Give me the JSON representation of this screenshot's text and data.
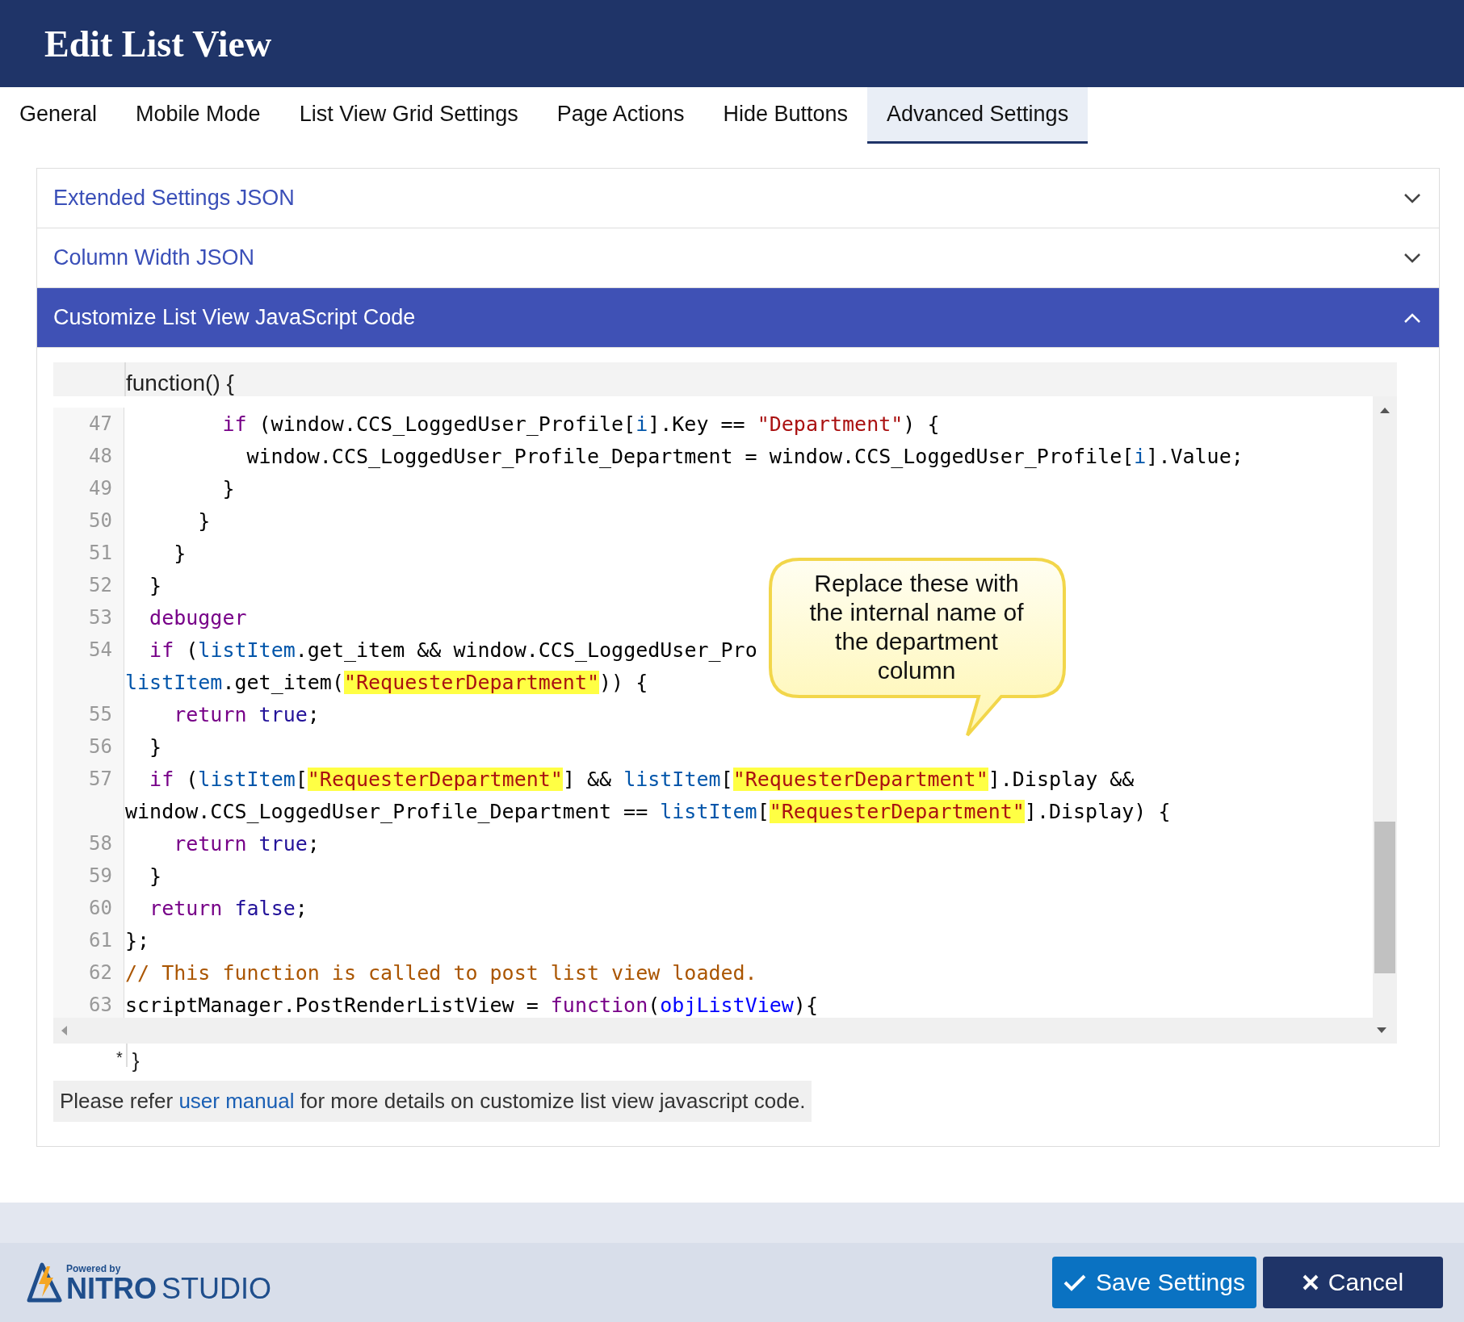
{
  "window": {
    "title": "Edit List View"
  },
  "tabs": [
    {
      "label": "General",
      "selected": false
    },
    {
      "label": "Mobile Mode",
      "selected": false
    },
    {
      "label": "List View Grid Settings",
      "selected": false
    },
    {
      "label": "Page Actions",
      "selected": false
    },
    {
      "label": "Hide Buttons",
      "selected": false
    },
    {
      "label": "Advanced Settings",
      "selected": true
    }
  ],
  "sections": [
    {
      "title": "Extended Settings JSON",
      "expanded": false
    },
    {
      "title": "Column Width JSON",
      "expanded": false
    },
    {
      "title": "Customize List View JavaScript Code",
      "expanded": true
    }
  ],
  "editor": {
    "header": "function() {",
    "footer_mark": "*",
    "footer_brace": "}",
    "lines": [
      {
        "number": "47",
        "tokens": [
          {
            "kind": "keyword",
            "text": "        if"
          },
          {
            "kind": "plain",
            "text": " (window.CCS_LoggedUser_Profile["
          },
          {
            "kind": "variable",
            "text": "i"
          },
          {
            "kind": "plain",
            "text": "].Key == "
          },
          {
            "kind": "string",
            "text": "\"Department\"",
            "highlighted": false
          },
          {
            "kind": "plain",
            "text": ") {"
          }
        ]
      },
      {
        "number": "48",
        "tokens": [
          {
            "kind": "plain",
            "text": "          window.CCS_LoggedUser_Profile_Department = window.CCS_LoggedUser_Profile["
          },
          {
            "kind": "variable",
            "text": "i"
          },
          {
            "kind": "plain",
            "text": "].Value;"
          }
        ]
      },
      {
        "number": "49",
        "tokens": [
          {
            "kind": "plain",
            "text": "        }"
          }
        ]
      },
      {
        "number": "50",
        "tokens": [
          {
            "kind": "plain",
            "text": "      }"
          }
        ]
      },
      {
        "number": "51",
        "tokens": [
          {
            "kind": "plain",
            "text": "    }"
          }
        ]
      },
      {
        "number": "52",
        "tokens": [
          {
            "kind": "plain",
            "text": "  }"
          }
        ]
      },
      {
        "number": "53",
        "tokens": [
          {
            "kind": "keyword",
            "text": "  debugger"
          }
        ]
      },
      {
        "number": "54",
        "tokens": [
          {
            "kind": "keyword",
            "text": "  if"
          },
          {
            "kind": "plain",
            "text": " ("
          },
          {
            "kind": "variable",
            "text": "listItem"
          },
          {
            "kind": "plain",
            "text": ".get_item && window.CCS_LoggedUser_Pro"
          }
        ]
      },
      {
        "tokens": [
          {
            "kind": "variable",
            "text": "listItem"
          },
          {
            "kind": "plain",
            "text": ".get_item("
          },
          {
            "kind": "string",
            "text": "\"RequesterDepartment\"",
            "highlighted": true
          },
          {
            "kind": "plain",
            "text": ")) {"
          }
        ]
      },
      {
        "number": "55",
        "tokens": [
          {
            "kind": "keyword",
            "text": "    return"
          },
          {
            "kind": "atom",
            "text": " true"
          },
          {
            "kind": "plain",
            "text": ";"
          }
        ]
      },
      {
        "number": "56",
        "tokens": [
          {
            "kind": "plain",
            "text": "  }"
          }
        ]
      },
      {
        "number": "57",
        "tokens": [
          {
            "kind": "keyword",
            "text": "  if"
          },
          {
            "kind": "plain",
            "text": " ("
          },
          {
            "kind": "variable",
            "text": "listItem"
          },
          {
            "kind": "plain",
            "text": "["
          },
          {
            "kind": "string",
            "text": "\"RequesterDepartment\"",
            "highlighted": true
          },
          {
            "kind": "plain",
            "text": "] && "
          },
          {
            "kind": "variable",
            "text": "listItem"
          },
          {
            "kind": "plain",
            "text": "["
          },
          {
            "kind": "string",
            "text": "\"RequesterDepartment\"",
            "highlighted": true
          },
          {
            "kind": "plain",
            "text": "].Display &&"
          }
        ]
      },
      {
        "tokens": [
          {
            "kind": "plain",
            "text": "window.CCS_LoggedUser_Profile_Department == "
          },
          {
            "kind": "variable",
            "text": "listItem"
          },
          {
            "kind": "plain",
            "text": "["
          },
          {
            "kind": "string",
            "text": "\"RequesterDepartment\"",
            "highlighted": true
          },
          {
            "kind": "plain",
            "text": "].Display) {"
          }
        ]
      },
      {
        "number": "58",
        "tokens": [
          {
            "kind": "keyword",
            "text": "    return"
          },
          {
            "kind": "atom",
            "text": " true"
          },
          {
            "kind": "plain",
            "text": ";"
          }
        ]
      },
      {
        "number": "59",
        "tokens": [
          {
            "kind": "plain",
            "text": "  }"
          }
        ]
      },
      {
        "number": "60",
        "tokens": [
          {
            "kind": "keyword",
            "text": "  return"
          },
          {
            "kind": "atom",
            "text": " false"
          },
          {
            "kind": "plain",
            "text": ";"
          }
        ]
      },
      {
        "number": "61",
        "tokens": [
          {
            "kind": "plain",
            "text": "};"
          }
        ]
      },
      {
        "number": "62",
        "tokens": [
          {
            "kind": "comment",
            "text": "// This function is called to post list view loaded."
          }
        ]
      },
      {
        "number": "63",
        "tokens": [
          {
            "kind": "plain",
            "text": "scriptManager.PostRenderListView = "
          },
          {
            "kind": "keyword",
            "text": "function"
          },
          {
            "kind": "plain",
            "text": "("
          },
          {
            "kind": "def",
            "text": "objListView"
          },
          {
            "kind": "plain",
            "text": "){"
          }
        ]
      }
    ]
  },
  "callout": {
    "text": "Replace these with the internal name of the department column"
  },
  "note": {
    "before": "Please refer ",
    "link": "user manual",
    "after": " for more details on customize list view javascript code."
  },
  "footer": {
    "logo": {
      "tagline": "Powered by",
      "brand_bold": "NITRO",
      "brand_light": "STUDIO"
    },
    "buttons": [
      {
        "kind": "save",
        "label": "Save Settings"
      },
      {
        "kind": "cancel",
        "label": "Cancel"
      }
    ]
  }
}
